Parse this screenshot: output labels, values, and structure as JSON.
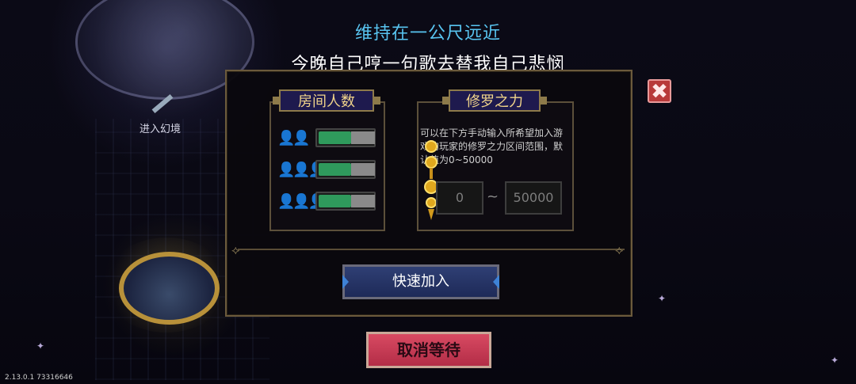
{
  "header": {
    "line1": "维持在一公尺远近",
    "line2": "今晚自己哼一句歌去替我自己悲悯"
  },
  "background": {
    "portal_label": "进入幻境"
  },
  "room_panel": {
    "title": "房间人数",
    "options": [
      {
        "icon": "two-people-icon",
        "glyph": "👤👤",
        "enabled": true,
        "fill": 0.6
      },
      {
        "icon": "three-people-icon",
        "glyph": "👤👤👤",
        "enabled": true,
        "fill": 0.6
      },
      {
        "icon": "four-people-icon",
        "glyph": "👤👤👤👤",
        "enabled": true,
        "fill": 0.6
      }
    ]
  },
  "power_panel": {
    "title": "修罗之力",
    "description": "可以在下方手动输入所希望加入游戏的玩家的修罗之力区间范围，默认值为0~50000",
    "min_value": "0",
    "separator": "~",
    "max_value": "50000"
  },
  "buttons": {
    "quick_join": "快速加入",
    "cancel_wait": "取消等待",
    "close": "✖"
  },
  "footer": {
    "version": "2.13.0.1 73316646"
  },
  "colors": {
    "line1": "#58c4f0",
    "title_tab": "#f0d48a",
    "toggle_on": "#2f9a5c",
    "join_button": "#2f3f74",
    "cancel_button": "#d84a62",
    "close_button": "#b83a3a"
  }
}
